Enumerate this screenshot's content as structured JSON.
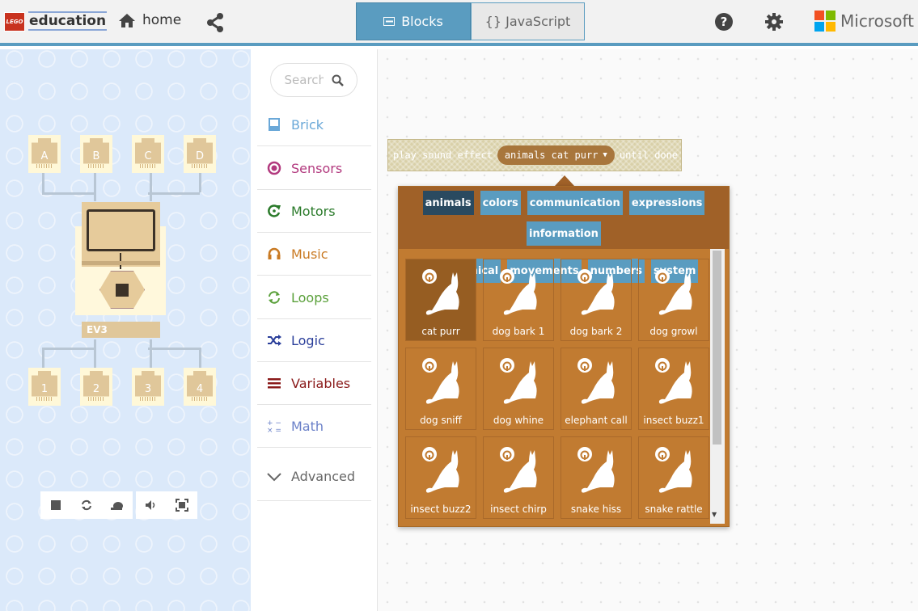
{
  "header": {
    "logo_brand": "LEGO",
    "logo_text": "education",
    "home_label": "home",
    "tabs": [
      {
        "label": "Blocks",
        "icon": "blocks-icon",
        "active": true
      },
      {
        "label": "{} JavaScript",
        "active": false
      }
    ],
    "microsoft_label": "Microsoft",
    "accent": "#5a9cc0"
  },
  "simulator": {
    "output_ports": [
      "A",
      "B",
      "C",
      "D"
    ],
    "input_ports": [
      "1",
      "2",
      "3",
      "4"
    ],
    "brick_label": "EV3",
    "controls": [
      "stop-icon",
      "restart-icon",
      "slow-motion-icon",
      "sound-icon",
      "fullscreen-icon"
    ]
  },
  "toolbox": {
    "search_placeholder": "Search",
    "categories": [
      {
        "label": "Brick",
        "color": "#6aa8d8",
        "icon": "brick-icon"
      },
      {
        "label": "Sensors",
        "color": "#b2397e",
        "icon": "sensors-icon"
      },
      {
        "label": "Motors",
        "color": "#2a7a2a",
        "icon": "motors-icon"
      },
      {
        "label": "Music",
        "color": "#c97a23",
        "icon": "headphones-icon"
      },
      {
        "label": "Loops",
        "color": "#5aa03a",
        "icon": "loops-icon"
      },
      {
        "label": "Logic",
        "color": "#2a3e9a",
        "icon": "shuffle-icon"
      },
      {
        "label": "Variables",
        "color": "#8a1a1a",
        "icon": "variables-icon"
      },
      {
        "label": "Math",
        "color": "#6a80c8",
        "icon": "math-icon"
      },
      {
        "label": "Advanced",
        "color": "#666666",
        "icon": "chevron-down-icon"
      }
    ]
  },
  "block": {
    "prefix": "play sound effect",
    "field_value": "animals cat purr",
    "suffix": "until done"
  },
  "dropdown": {
    "categories": [
      {
        "label": "animals",
        "selected": true
      },
      {
        "label": "colors"
      },
      {
        "label": "communication"
      },
      {
        "label": "expressions"
      },
      {
        "label": "information"
      },
      {
        "label": "mechanical"
      },
      {
        "label": "movements"
      },
      {
        "label": "numbers"
      },
      {
        "label": "system"
      }
    ],
    "sounds": [
      {
        "label": "cat purr",
        "selected": true
      },
      {
        "label": "dog bark 1"
      },
      {
        "label": "dog bark 2"
      },
      {
        "label": "dog growl"
      },
      {
        "label": "dog sniff"
      },
      {
        "label": "dog whine"
      },
      {
        "label": "elephant call"
      },
      {
        "label": "insect buzz1"
      },
      {
        "label": "insect buzz2"
      },
      {
        "label": "insect chirp"
      },
      {
        "label": "snake hiss"
      },
      {
        "label": "snake rattle"
      }
    ]
  }
}
